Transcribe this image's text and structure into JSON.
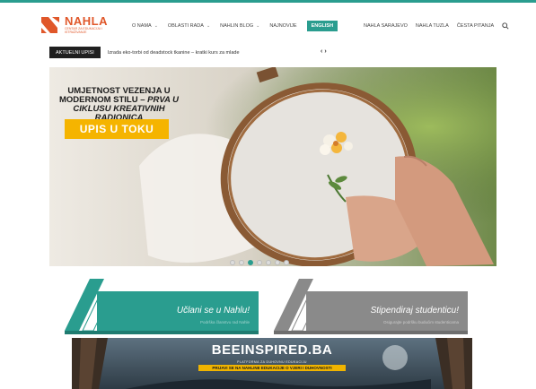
{
  "brand": {
    "name": "NAHLA",
    "subtitle": "Centar za edukaciju i istraživanje",
    "color": "#e0572a"
  },
  "nav": {
    "items": [
      {
        "label": "O nama",
        "dropdown": true
      },
      {
        "label": "Oblasti rada",
        "dropdown": true
      },
      {
        "label": "Nahlin blog",
        "dropdown": true
      },
      {
        "label": "Najnovije",
        "dropdown": false
      }
    ],
    "cta_label": "English",
    "right_items": [
      {
        "label": "Nahla Sarajevo"
      },
      {
        "label": "Nahla Tuzla"
      },
      {
        "label": "Česta pitanja"
      }
    ],
    "search_icon": "search-icon"
  },
  "ticker": {
    "label": "Aktuelni upisi",
    "text": "Izrada eko-torbi od deadstock tkanine – kratki kurs za mlade",
    "prev_icon": "chevron-left-icon",
    "next_icon": "chevron-right-icon"
  },
  "hero": {
    "title_line1": "UMJETNOST VEZENJA U",
    "title_line2_bold": "MODERNOM STILU –",
    "title_line2_italic": " PRVA U",
    "title_line3": "CIKLUSU KREATIVNIH RADIONICA",
    "badge": "UPIS U TOKU",
    "slide_count": 7,
    "active_slide": 2
  },
  "cards": [
    {
      "title": "Učlani se u Nahlu!",
      "subtitle": "Podrška članstvu rad Nahle",
      "color": "#2a9d8f"
    },
    {
      "title": "Stipendiraj studenticu!",
      "subtitle": "Osigurajte podršku budućim studenticama",
      "color": "#8a8a8a"
    }
  ],
  "banner": {
    "title": "BEEINSPIRED.BA",
    "subtitle": "Platforma za duhovnu edukaciju",
    "cta": "Prijavi se na Nahline edukacije o vjeri i duhovnosti"
  },
  "colors": {
    "accent": "#2a9d8f",
    "badge": "#f5b400"
  }
}
